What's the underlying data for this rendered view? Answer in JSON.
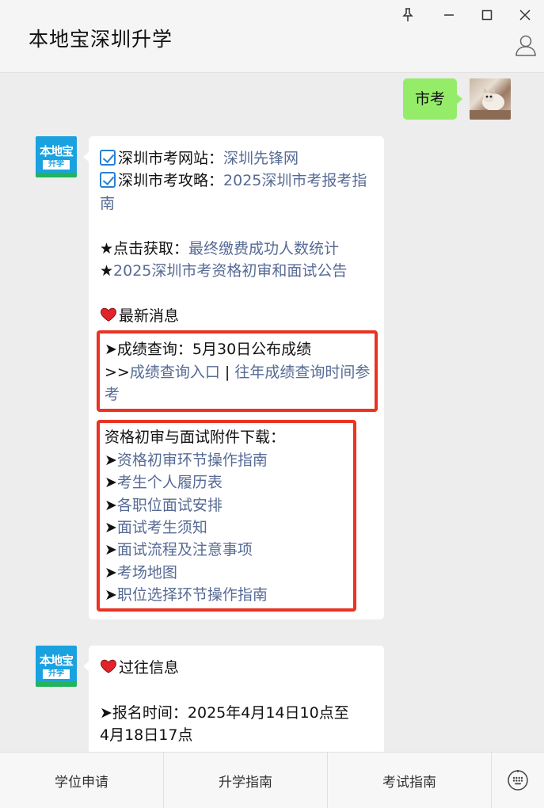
{
  "window": {
    "title": "本地宝深圳升学"
  },
  "logo": {
    "line1": "本地宝",
    "line2": "升学"
  },
  "chat": {
    "user_message": "市考",
    "reply1": {
      "line_website_prefix": "深圳市考网站：",
      "line_website_link": "深圳先锋网",
      "line_guide_prefix": "深圳市考攻略：",
      "line_guide_link": "2025深圳市考报考指南",
      "line_stats_prefix": "★点击获取：",
      "line_stats_link": "最终缴费成功人数统计",
      "line_notice_star": "★",
      "line_notice_link": "2025深圳市考资格初审和面试公告",
      "latest_news": "最新消息",
      "score_query": "➤成绩查询：5月30日公布成绩",
      "score_prefix": ">>",
      "score_link1": "成绩查询入口",
      "score_sep": " | ",
      "score_link2": "往年成绩查询时间参考",
      "download_title": "资格初审与面试附件下载：",
      "arrow": "➤",
      "download_links": [
        "资格初审环节操作指南",
        "考生个人履历表",
        "各职位面试安排",
        "面试考生须知",
        "面试流程及注意事项",
        "考场地图",
        "职位选择环节操作指南"
      ]
    },
    "reply2": {
      "past_info": "过往信息",
      "reg_time_line1": "➤报名时间：2025年4月14日10点至",
      "reg_time_line2": "4月18日17点"
    }
  },
  "bottom_menu": {
    "items": [
      "学位申请",
      "升学指南",
      "考试指南"
    ]
  },
  "colors": {
    "link": "#576b95",
    "user_bubble": "#95ec69",
    "highlight_border": "#ea3323",
    "logo_blue": "#1aa1e0"
  }
}
